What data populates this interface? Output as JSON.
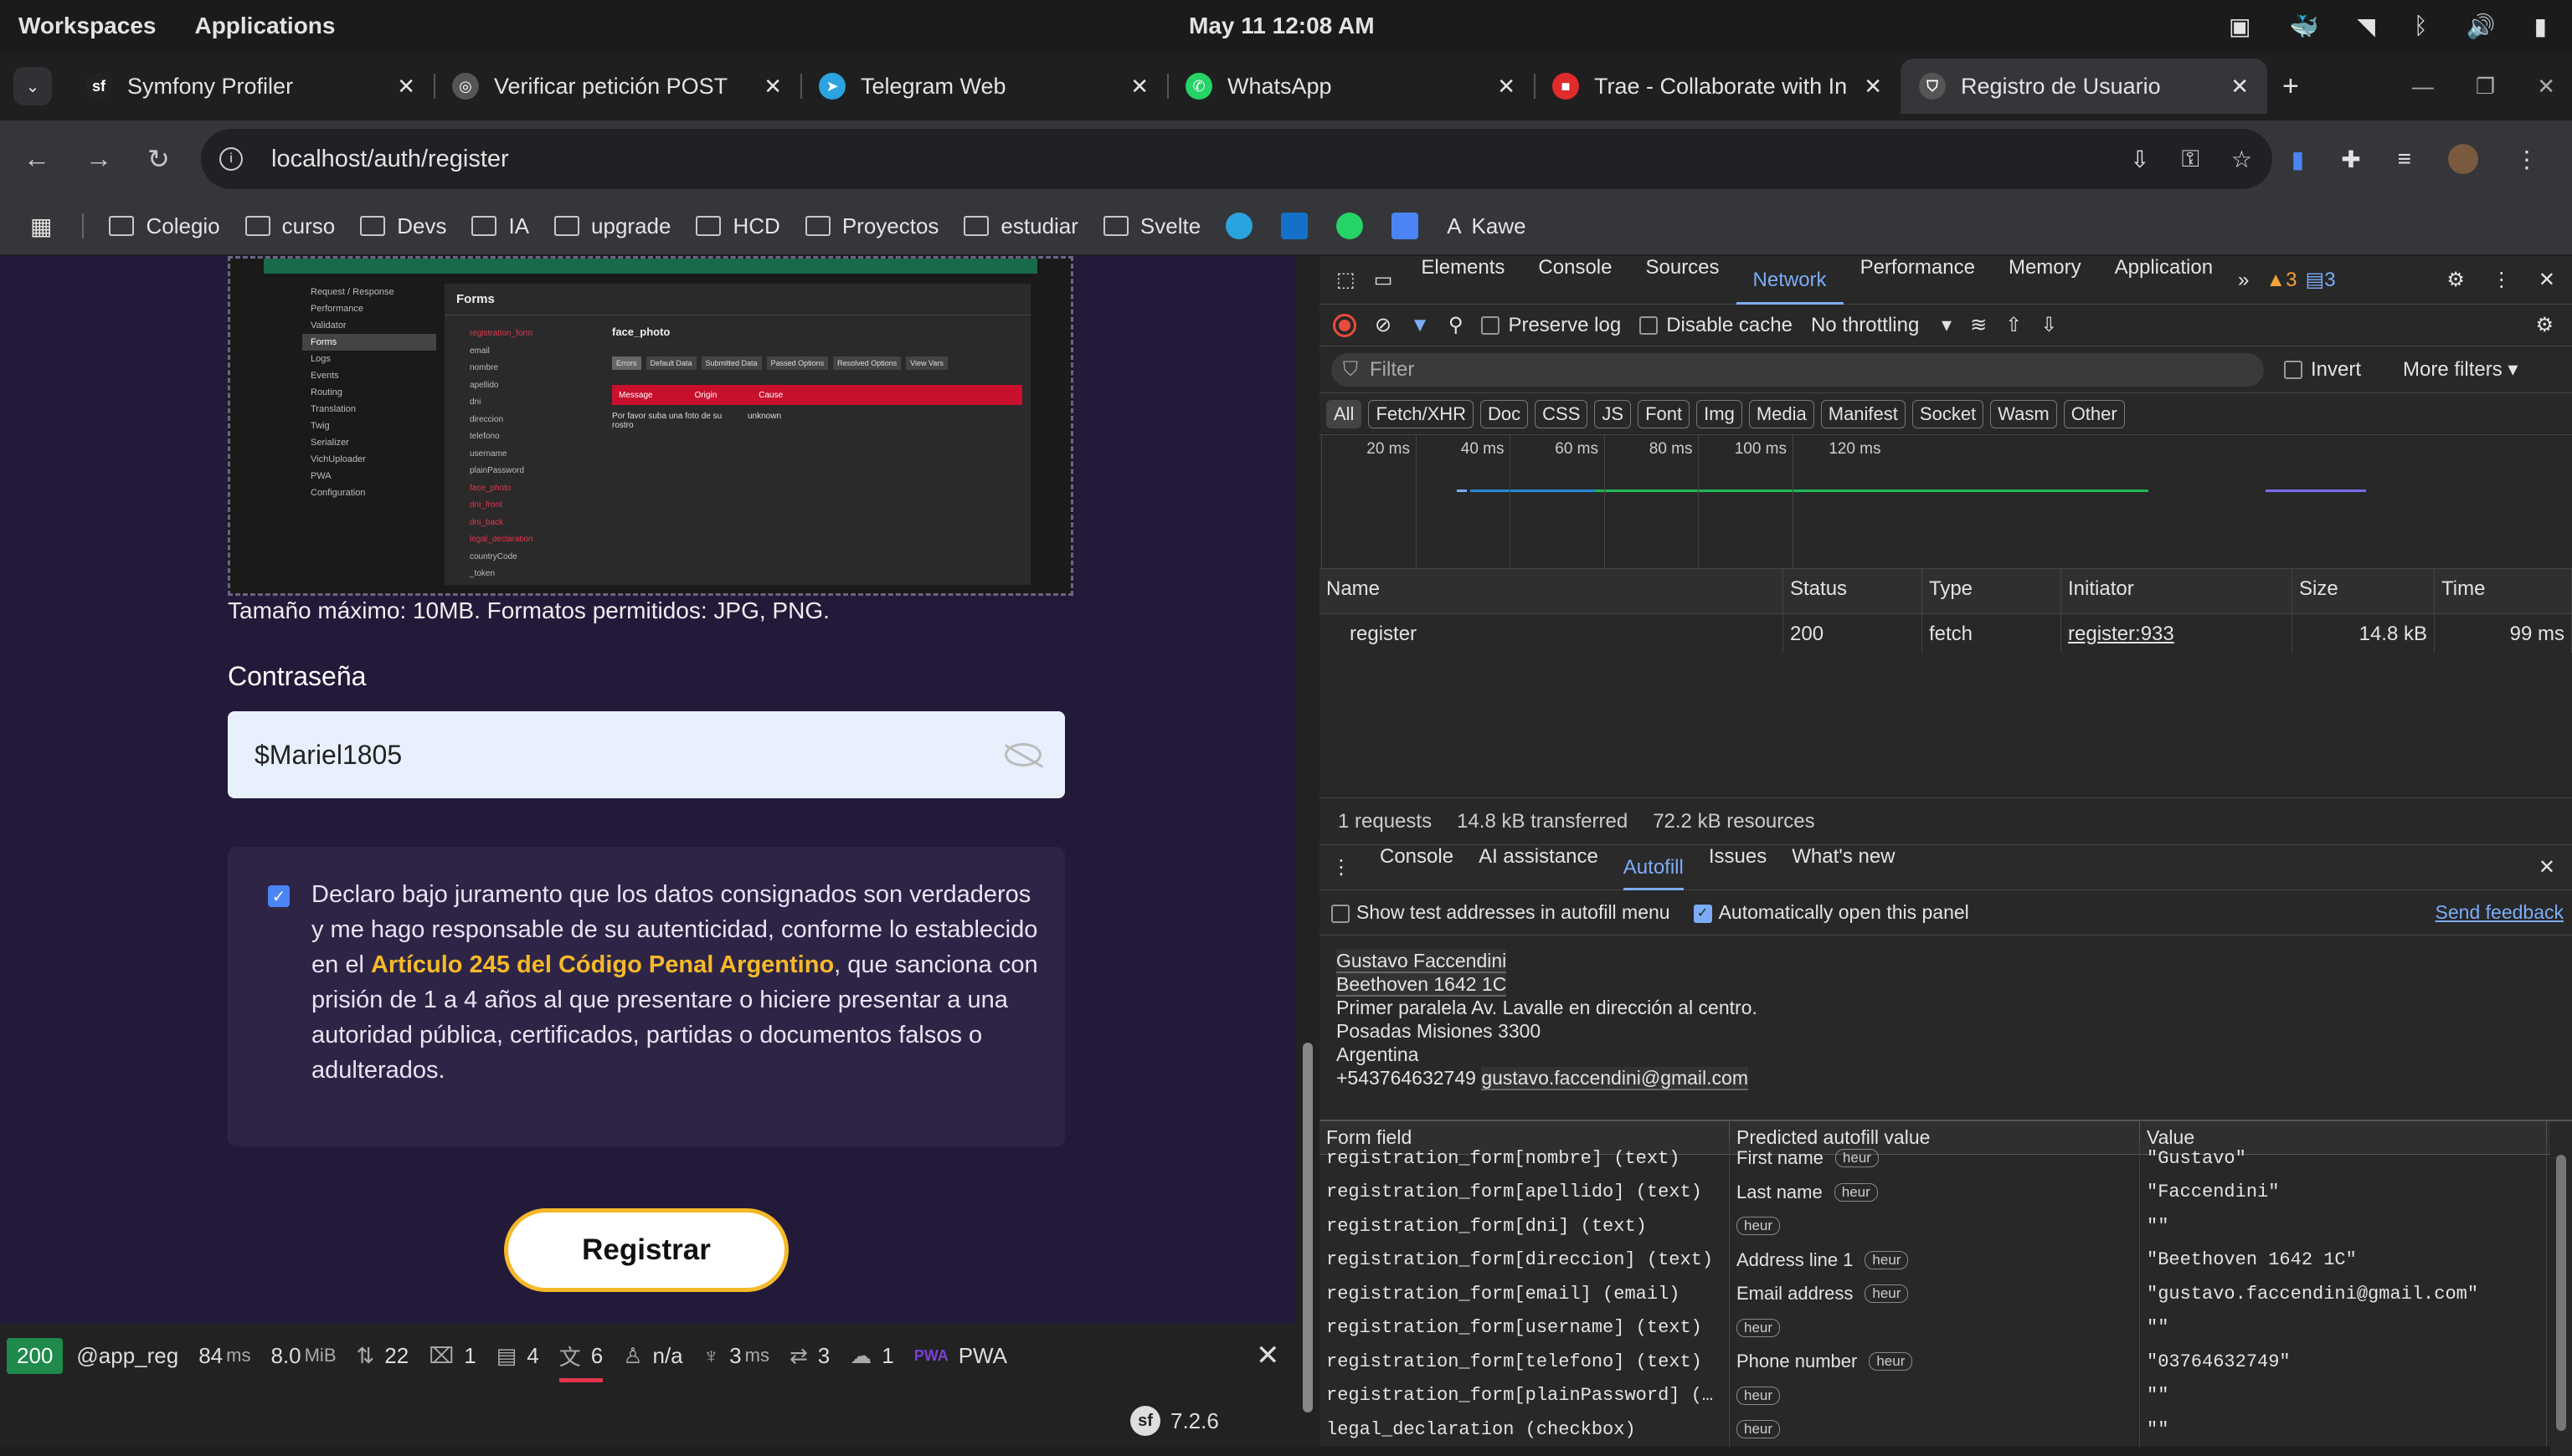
{
  "system": {
    "workspaces": "Workspaces",
    "applications": "Applications",
    "datetime": "May 11  12:08 AM"
  },
  "tabs": [
    {
      "title": "Symfony Profiler",
      "icon": "sf",
      "color": "#222"
    },
    {
      "title": "Verificar petición POST",
      "icon": "◎",
      "color": "#555"
    },
    {
      "title": "Telegram Web",
      "icon": "➤",
      "color": "#2aa3de"
    },
    {
      "title": "WhatsApp",
      "icon": "✆",
      "color": "#25d366"
    },
    {
      "title": "Trae - Collaborate with In",
      "icon": "■",
      "color": "#e02b2b"
    },
    {
      "title": "Registro de Usuario",
      "icon": "⛉",
      "color": "#555"
    }
  ],
  "address": {
    "url": "localhost/auth/register"
  },
  "bookmarks": [
    "Colegio",
    "curso",
    "Devs",
    "IA",
    "upgrade",
    "HCD",
    "Proyectos",
    "estudiar",
    "Svelte"
  ],
  "bookmark_last": "Kawe",
  "form": {
    "embedded_shot": {
      "forms_title": "Forms",
      "field_title": "face_photo",
      "message": "Por favor suba una foto de su rostro",
      "origin": "unknown",
      "table_headers": [
        "Message",
        "Origin",
        "Cause"
      ],
      "tabs": [
        "Errors",
        "Default Data",
        "Submitted Data",
        "Passed Options",
        "Resolved Options",
        "View Vars"
      ],
      "side": [
        "Request / Response",
        "Performance",
        "Validator",
        "Forms",
        "Logs",
        "Events",
        "Routing",
        "Translation",
        "Twig",
        "Serializer",
        "VichUploader",
        "PWA",
        "Configuration"
      ],
      "fields": [
        "registration_form",
        "email",
        "nombre",
        "apellido",
        "dni",
        "direccion",
        "telefono",
        "username",
        "plainPassword",
        "face_photo",
        "dni_front",
        "dni_back",
        "legal_declaration",
        "countryCode",
        "_token"
      ]
    },
    "hint": "Tamaño máximo: 10MB. Formatos permitidos: JPG, PNG.",
    "password_label": "Contraseña",
    "password_value": "$Mariel1805",
    "declaration_pre": "Declaro bajo juramento que los datos consignados son verdaderos y me hago responsable de su autenticidad, conforme lo establecido en el ",
    "declaration_link": "Artículo 245 del Código Penal Argentino",
    "declaration_post": ", que sanciona con prisión de 1 a 4 años al que presentare o hiciere presentar a una autoridad pública, certificados, partidas o documentos falsos o adulterados.",
    "submit": "Registrar"
  },
  "toolbar": {
    "status": "200",
    "route": "@app_reg",
    "time": "84",
    "time_unit": "ms",
    "memory": "8.0",
    "memory_unit": "MiB",
    "requests": "22",
    "logs": "1",
    "forms": "4",
    "translations": "6",
    "user": "n/a",
    "twig": "3",
    "twig_unit": "ms",
    "events": "3",
    "cache": "1",
    "pwa": "PWA",
    "version": "7.2.6"
  },
  "devtools": {
    "tabs": [
      "Elements",
      "Console",
      "Sources",
      "Network",
      "Performance",
      "Memory",
      "Application"
    ],
    "warnings": "3",
    "messages": "3",
    "preserve_log": "Preserve log",
    "disable_cache": "Disable cache",
    "throttling": "No throttling",
    "filter_placeholder": "Filter",
    "invert": "Invert",
    "more_filters": "More filters",
    "types": [
      "All",
      "Fetch/XHR",
      "Doc",
      "CSS",
      "JS",
      "Font",
      "Img",
      "Media",
      "Manifest",
      "Socket",
      "Wasm",
      "Other"
    ],
    "ticks": [
      "20 ms",
      "40 ms",
      "60 ms",
      "80 ms",
      "100 ms",
      "120 ms"
    ],
    "columns": [
      "Name",
      "Status",
      "Type",
      "Initiator",
      "Size",
      "Time"
    ],
    "rows": [
      {
        "name": "register",
        "status": "200",
        "type": "fetch",
        "initiator": "register:933",
        "size": "14.8 kB",
        "time": "99 ms"
      }
    ],
    "summary": [
      "1 requests",
      "14.8 kB transferred",
      "72.2 kB resources"
    ],
    "drawer_tabs": [
      "Console",
      "AI assistance",
      "Autofill",
      "Issues",
      "What's new"
    ],
    "autofill": {
      "show_test": "Show test addresses in autofill menu",
      "auto_open": "Automatically open this panel",
      "feedback": "Send feedback",
      "address": [
        "Gustavo Faccendini",
        "Beethoven 1642 1C",
        "Primer paralela Av. Lavalle en dirección al centro.",
        "Posadas Misiones 3300",
        "Argentina"
      ],
      "phone": "+543764632749",
      "email": "gustavo.faccendini@gmail.com",
      "headers": [
        "Form field",
        "Predicted autofill value",
        "Value"
      ],
      "rows": [
        {
          "field": "registration_form[nombre] (text)",
          "pred": "First name",
          "val": "\"Gustavo\""
        },
        {
          "field": "registration_form[apellido] (text)",
          "pred": "Last name",
          "val": "\"Faccendini\""
        },
        {
          "field": "registration_form[dni] (text)",
          "pred": "",
          "val": "\"\""
        },
        {
          "field": "registration_form[direccion] (text)",
          "pred": "Address line 1",
          "val": "\"Beethoven 1642 1C\""
        },
        {
          "field": "registration_form[email] (email)",
          "pred": "Email address",
          "val": "\"gustavo.faccendini@gmail.com\""
        },
        {
          "field": "registration_form[username] (text)",
          "pred": "",
          "val": "\"\""
        },
        {
          "field": "registration_form[telefono] (text)",
          "pred": "Phone number",
          "val": "\"03764632749\""
        },
        {
          "field": "registration_form[plainPassword] (…",
          "pred": "",
          "val": "\"\""
        },
        {
          "field": "legal_declaration (checkbox)",
          "pred": "",
          "val": "\"\""
        }
      ],
      "heur": "heur"
    }
  }
}
